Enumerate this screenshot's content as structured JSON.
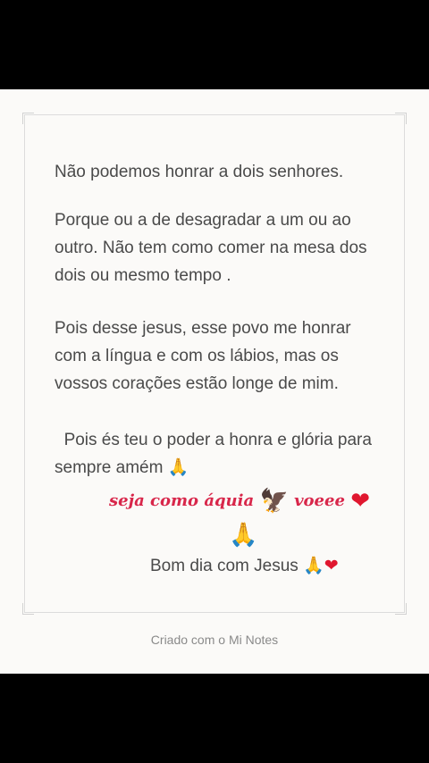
{
  "note": {
    "paragraph_1": "Não podemos honrar a dois senhores.",
    "paragraph_2": "Porque ou a de desagradar a um ou ao outro. Não tem como comer na mesa dos dois ou mesmo tempo .",
    "paragraph_3": "Pois desse jesus, esse povo me honrar com a língua e com os lábios, mas os vossos corações estão longe de mim.",
    "paragraph_4": "Pois és teu o poder a honra e glória para sempre amém",
    "script_part_1": "seja como áquia",
    "script_part_2": "voeee",
    "closing": "Bom dia com Jesus"
  },
  "icons": {
    "pray": "🙏",
    "eagle": "🦅",
    "heart": "❤"
  },
  "footer": {
    "created_with": "Criado com o Mi Notes"
  },
  "colors": {
    "accent_script": "#d8264a",
    "body_text": "#4a4a4a",
    "card_background": "#fbfaf8"
  }
}
